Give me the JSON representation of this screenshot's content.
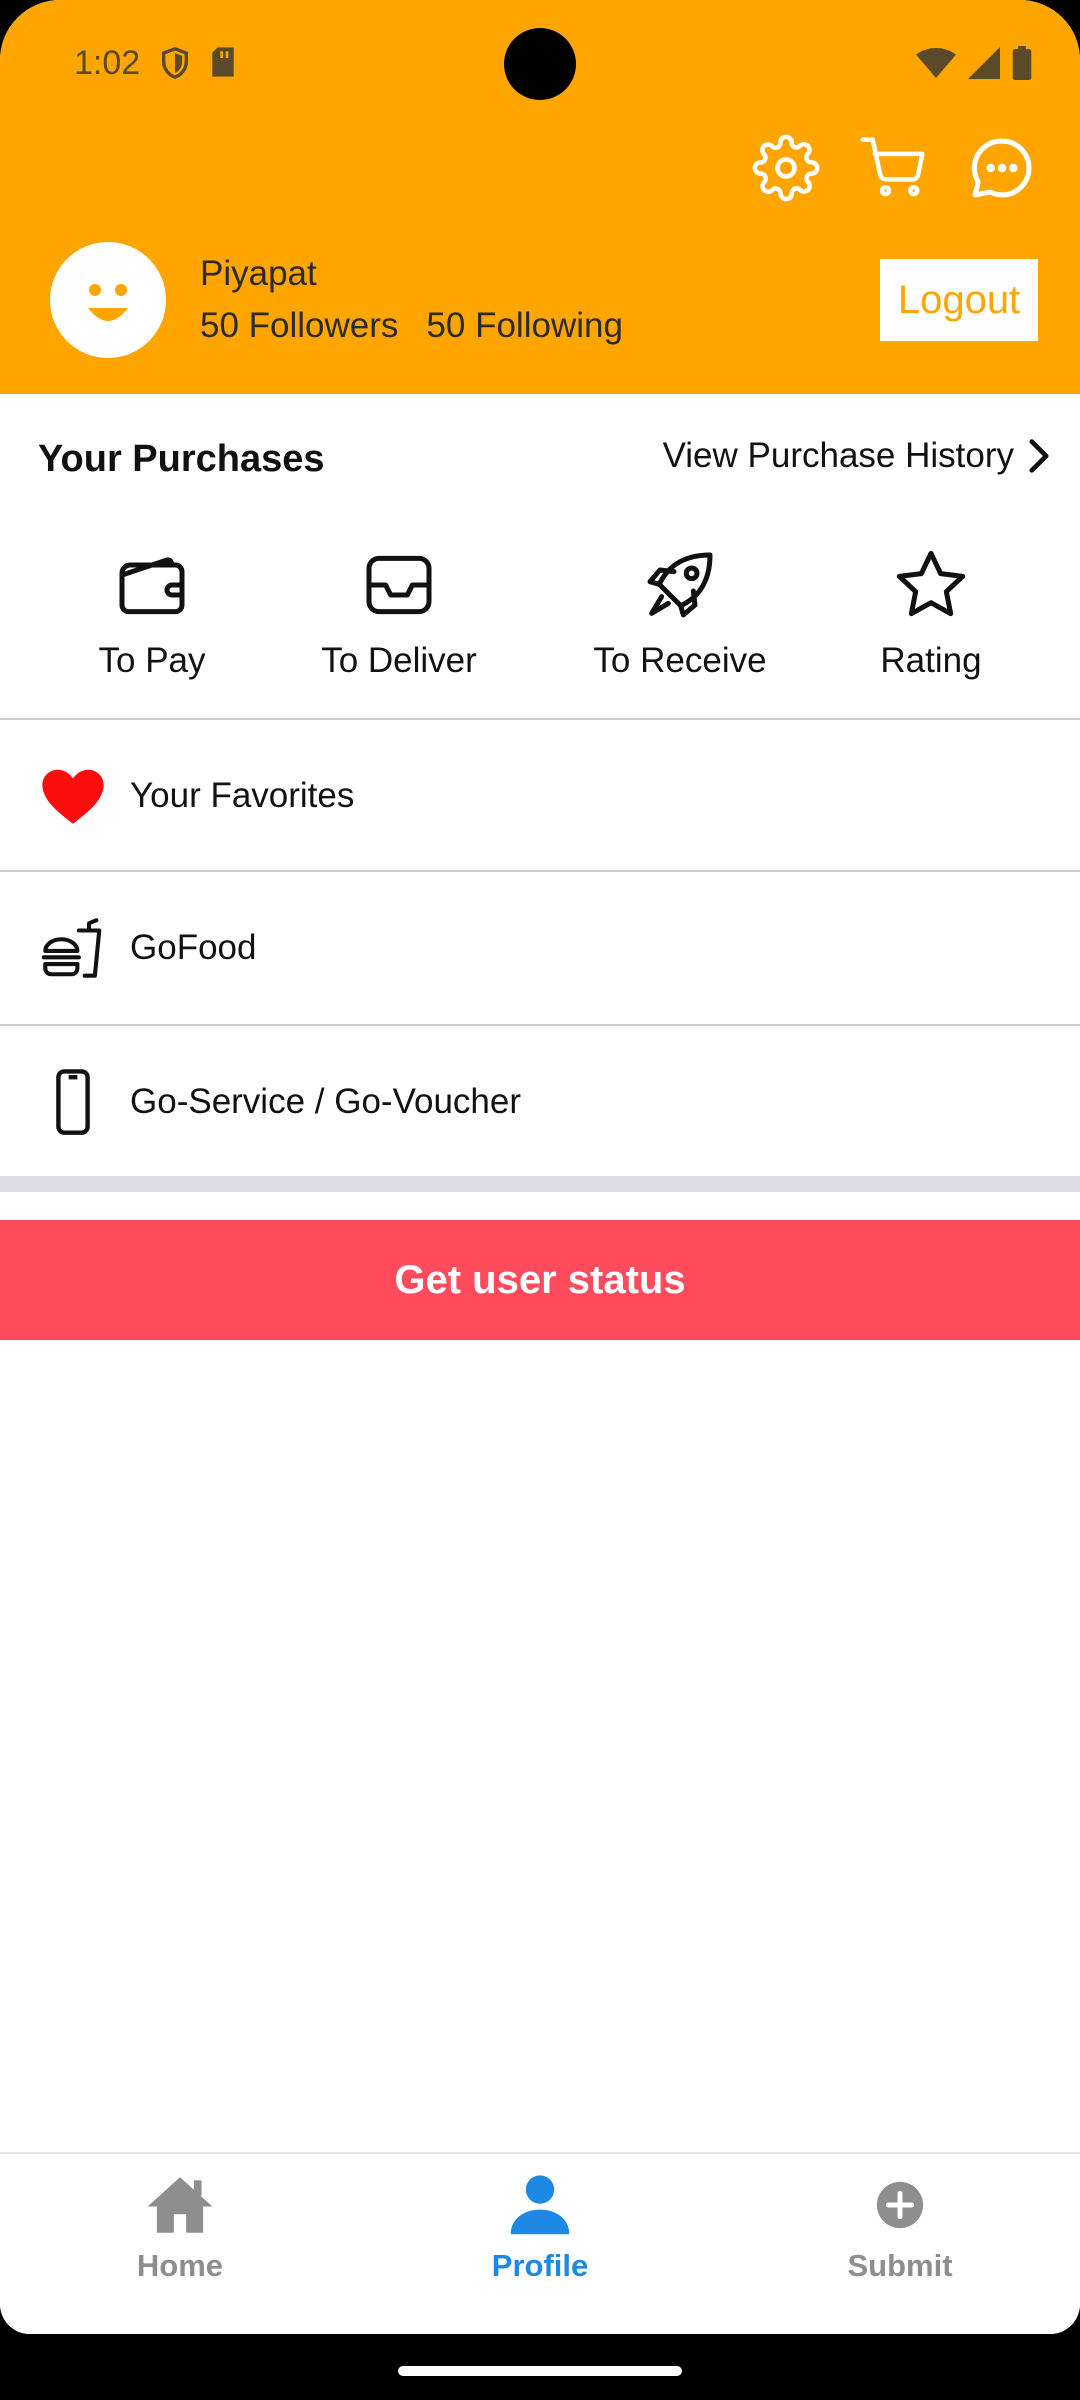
{
  "status_bar": {
    "time": "1:02"
  },
  "header": {
    "username": "Piyapat",
    "followers": "50 Followers",
    "following": "50 Following",
    "logout_label": "Logout",
    "accent": "#FFA500"
  },
  "purchases": {
    "title": "Your Purchases",
    "view_history": "View Purchase History",
    "items": [
      {
        "label": "To Pay",
        "icon": "wallet-icon"
      },
      {
        "label": "To Deliver",
        "icon": "inbox-icon"
      },
      {
        "label": "To Receive",
        "icon": "rocket-icon"
      },
      {
        "label": "Rating",
        "icon": "star-icon"
      }
    ]
  },
  "menu": [
    {
      "label": "Your Favorites",
      "icon": "heart-icon"
    },
    {
      "label": "GoFood",
      "icon": "fastfood-icon"
    },
    {
      "label": "Go-Service / Go-Voucher",
      "icon": "phone-icon"
    }
  ],
  "status_button": {
    "label": "Get user status",
    "color": "#FF4B5C"
  },
  "bottom_nav": {
    "items": [
      {
        "label": "Home",
        "icon": "home-icon",
        "active": false
      },
      {
        "label": "Profile",
        "icon": "person-icon",
        "active": true
      },
      {
        "label": "Submit",
        "icon": "plus-circle-icon",
        "active": false
      }
    ],
    "active_color": "#1E88E5"
  }
}
